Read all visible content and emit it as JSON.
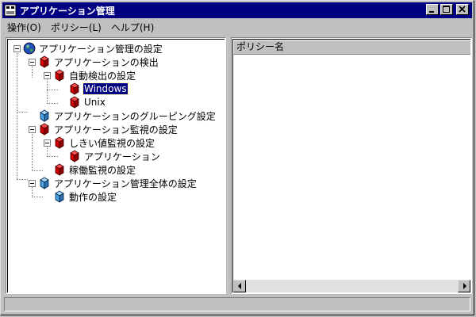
{
  "window": {
    "title": "アプリケーション管理"
  },
  "menu": [
    {
      "label": "操作(O)"
    },
    {
      "label": "ポリシー(L)"
    },
    {
      "label": "ヘルプ(H)"
    }
  ],
  "tree": [
    {
      "label": "アプリケーション管理の設定",
      "icon": "globe-icon",
      "selected": false
    },
    {
      "label": "アプリケーションの検出",
      "icon": "red-cube-icon",
      "selected": false
    },
    {
      "label": "自動検出の設定",
      "icon": "red-cube-icon",
      "selected": false
    },
    {
      "label": "Windows",
      "icon": "red-cube-icon",
      "selected": true
    },
    {
      "label": "Unix",
      "icon": "red-cube-icon",
      "selected": false
    },
    {
      "label": "アプリケーションのグルーピング設定",
      "icon": "blue-cube-icon",
      "selected": false
    },
    {
      "label": "アプリケーション監視の設定",
      "icon": "red-cube-icon",
      "selected": false
    },
    {
      "label": "しきい値監視の設定",
      "icon": "red-cube-icon",
      "selected": false
    },
    {
      "label": "アプリケーション",
      "icon": "red-cube-icon",
      "selected": false
    },
    {
      "label": "稼働監視の設定",
      "icon": "red-cube-icon",
      "selected": false
    },
    {
      "label": "アプリケーション管理全体の設定",
      "icon": "blue-cube-icon",
      "selected": false
    },
    {
      "label": "動作の設定",
      "icon": "blue-cube-icon",
      "selected": false
    }
  ],
  "list": {
    "column_header": "ポリシー名"
  },
  "colors": {
    "titlebar": "#000080",
    "face": "#c0c0c0",
    "red_cube": "#cc0000",
    "blue_cube": "#3a8fd0"
  }
}
